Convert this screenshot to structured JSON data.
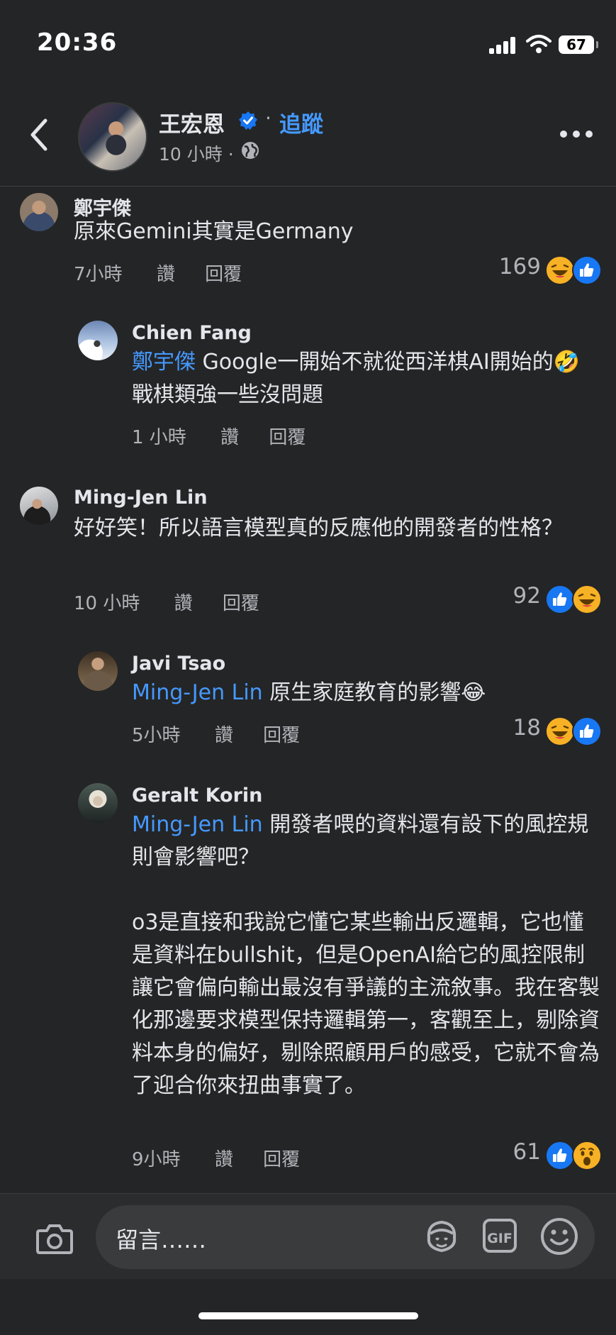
{
  "status_bar": {
    "time": "20:36",
    "battery": "67"
  },
  "post_header": {
    "author": "王宏恩",
    "separator": "·",
    "follow_label": "追蹤",
    "time": "10 小時 ·"
  },
  "comments": [
    {
      "name": "鄭宇傑",
      "text": "原來Gemini其實是Germany",
      "time": "7小時",
      "like_label": "讚",
      "reply_label": "回覆",
      "reaction_count": "169",
      "reactions": [
        "haha",
        "like"
      ]
    },
    {
      "name": "Chien Fang",
      "mention": "鄭宇傑",
      "text": " Google一開始不就從西洋棋AI開始的🤣 戰棋類強一些沒問題",
      "time": "1 小時",
      "like_label": "讚",
      "reply_label": "回覆"
    },
    {
      "name": "Ming-Jen Lin",
      "text": "好好笑！所以語言模型真的反應他的開發者的性格？",
      "time": "10 小時",
      "like_label": "讚",
      "reply_label": "回覆",
      "reaction_count": "92",
      "reactions": [
        "like",
        "haha"
      ]
    },
    {
      "name": "Javi Tsao",
      "mention": "Ming-Jen Lin",
      "text": " 原生家庭教育的影響😂",
      "time": "5小時",
      "like_label": "讚",
      "reply_label": "回覆",
      "reaction_count": "18",
      "reactions": [
        "haha",
        "like"
      ]
    },
    {
      "name": "Geralt Korin",
      "mention": "Ming-Jen Lin",
      "text": " 開發者喂的資料還有設下的風控規則會影響吧？",
      "text2": "o3是直接和我說它懂它某些輸出反邏輯，它也懂是資料在bullshit，但是OpenAI給它的風控限制讓它會偏向輸出最沒有爭議的主流敘事。我在客製化那邊要求模型保持邏輯第一，客觀至上，剔除資料本身的偏好，剔除照顧用戶的感受，它就不會為了迎合你來扭曲事實了。",
      "time": "9小時",
      "like_label": "讚",
      "reply_label": "回覆",
      "reaction_count": "61",
      "reactions": [
        "like",
        "wow"
      ]
    }
  ],
  "composer": {
    "placeholder": "留言……",
    "gif_label": "GIF"
  },
  "icons": {
    "back": "chevron-left-icon",
    "verified": "verified-badge-icon",
    "audience": "globe-icon",
    "more": "more-dots-icon",
    "camera": "camera-icon",
    "avatar_sticker": "avatar-sticker-icon",
    "emoji": "smiley-icon"
  },
  "colors": {
    "background": "#242526",
    "link": "#4599ff",
    "secondary_text": "#b0b3b8",
    "like_blue": "#1877f2"
  }
}
